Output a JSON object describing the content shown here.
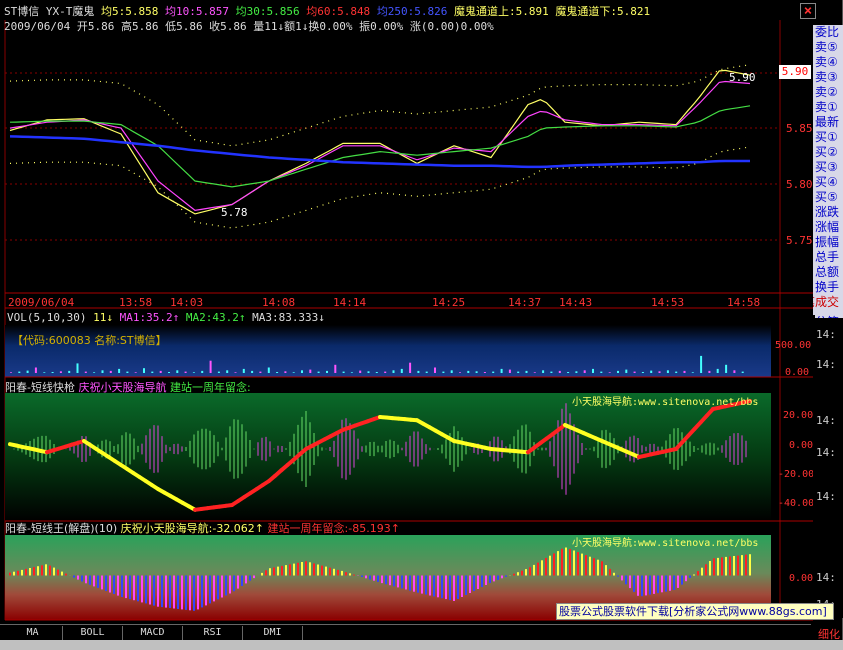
{
  "title_bar": {
    "stock": "ST博信",
    "indicator": "YX-T魔鬼",
    "ma5": "均5:5.858",
    "ma10": "均10:5.857",
    "ma30": "均30:5.856",
    "ma60": "均60:5.848",
    "ma250": "均250:5.826",
    "chan_up": "魔鬼通道上:5.891",
    "chan_down": "魔鬼通道下:5.821"
  },
  "quote_line": "2009/06/04 开5.86 高5.86 低5.86 收5.86 量11↓额1↓换0.00% 振0.00% 涨(0.00)0.00%",
  "price_panel": {
    "current_price_label": "5.90",
    "high_annotation": "5.90",
    "low_annotation": "5.78",
    "yticks": [
      "5.90",
      "5.85",
      "5.80",
      "5.75"
    ]
  },
  "time_axis": [
    "2009/06/04",
    "13:58",
    "14:03",
    "14:08",
    "14:14",
    "14:25",
    "14:37",
    "14:43",
    "14:53",
    "14:58"
  ],
  "side_panel": [
    "委比",
    "卖⑤",
    "卖④",
    "卖③",
    "卖②",
    "卖①",
    "最新",
    "买①",
    "买②",
    "买③",
    "买④",
    "买⑤",
    "涨跌",
    "涨幅",
    "振幅",
    "总手",
    "总额",
    "换手",
    "分笔成交",
    "分笔"
  ],
  "vol_panel": {
    "header_vol": "VOL(5,10,30)",
    "header_val": "11↓",
    "ma1": "MA1:35.2↑",
    "ma2": "MA2:43.2↑",
    "ma3": "MA3:83.333↓",
    "code_label": "【代码:600083 名称:ST博信】",
    "yticks": [
      "500.00",
      "0.00"
    ]
  },
  "osc_panel": {
    "title": "阳春-短线快枪",
    "sub1": "庆祝小天股海导航",
    "sub2": "建站一周年留念:",
    "watermark": "小天股海导航:www.sitenova.net/bbs",
    "yticks": [
      "20.00",
      "0.00",
      "-20.00",
      "-40.00"
    ]
  },
  "king_panel": {
    "title": "阳春-短线王(解盘)(10)",
    "sub1": "庆祝小天股海导航:-32.062↑",
    "sub2": "建站一周年留念:-85.193↑",
    "watermark": "小天股海导航:www.sitenova.net/bbs",
    "yticks": [
      "0.00"
    ]
  },
  "right_times": [
    "14:",
    "14:",
    "14:",
    "14:",
    "14:",
    "14:",
    "14:"
  ],
  "promo": "股票公式股票软件下载[分析家公式网www.88gs.com]",
  "tabs": [
    "MA",
    "BOLL",
    "MACD",
    "RSI",
    "DMI"
  ],
  "bottom_right": "细化",
  "colors": {
    "price_up": "#ff3333",
    "ma5": "#ffff66",
    "ma10": "#ff44ff",
    "ma30": "#44dd44",
    "ma250": "#2233ff",
    "grid": "#880000"
  },
  "chart_data": [
    {
      "type": "line",
      "title": "ST博信 YX-T魔鬼",
      "x": [
        0,
        0.05,
        0.1,
        0.15,
        0.2,
        0.25,
        0.3,
        0.35,
        0.4,
        0.45,
        0.5,
        0.55,
        0.6,
        0.65,
        0.7,
        0.72,
        0.75,
        0.8,
        0.85,
        0.9,
        0.93,
        0.96,
        1.0
      ],
      "series": [
        {
          "name": "均5",
          "values": [
            5.853,
            5.862,
            5.863,
            5.85,
            5.8,
            5.782,
            5.79,
            5.81,
            5.825,
            5.842,
            5.842,
            5.825,
            5.84,
            5.83,
            5.875,
            5.88,
            5.86,
            5.857,
            5.86,
            5.858,
            5.88,
            5.905,
            5.9
          ]
        },
        {
          "name": "均10",
          "values": [
            5.855,
            5.86,
            5.862,
            5.855,
            5.81,
            5.785,
            5.79,
            5.81,
            5.823,
            5.84,
            5.84,
            5.828,
            5.838,
            5.835,
            5.865,
            5.87,
            5.862,
            5.858,
            5.858,
            5.857,
            5.875,
            5.895,
            5.893
          ]
        },
        {
          "name": "均30",
          "values": [
            5.86,
            5.861,
            5.861,
            5.858,
            5.84,
            5.81,
            5.805,
            5.81,
            5.82,
            5.83,
            5.835,
            5.832,
            5.835,
            5.838,
            5.848,
            5.855,
            5.856,
            5.857,
            5.857,
            5.856,
            5.86,
            5.87,
            5.874
          ]
        },
        {
          "name": "均250",
          "values": [
            5.848,
            5.847,
            5.846,
            5.843,
            5.84,
            5.836,
            5.833,
            5.83,
            5.828,
            5.826,
            5.825,
            5.824,
            5.823,
            5.823,
            5.822,
            5.822,
            5.823,
            5.824,
            5.825,
            5.826,
            5.826,
            5.827,
            5.827
          ]
        }
      ],
      "ylim": [
        5.73,
        5.93
      ]
    },
    {
      "type": "bar",
      "title": "VOL(5,10,30)",
      "values": [
        10,
        20,
        35,
        80,
        10,
        15,
        25,
        30,
        140,
        20,
        10,
        40,
        30,
        60,
        20,
        10,
        70,
        20,
        30,
        15,
        40,
        20,
        10,
        30,
        180,
        20,
        40,
        10,
        60,
        30,
        20,
        80,
        15,
        25,
        10,
        40,
        50,
        20,
        30,
        120,
        20,
        10,
        35,
        25,
        15,
        20,
        40,
        60,
        150,
        30,
        20,
        80,
        20,
        40,
        10,
        30,
        25,
        15,
        20,
        60,
        50,
        20,
        30,
        10,
        40,
        20,
        30,
        15,
        25,
        40,
        60,
        20,
        10,
        30,
        50,
        20,
        15,
        35,
        25,
        40,
        20,
        30,
        10,
        250,
        30,
        60,
        120,
        40,
        20
      ],
      "ylim": [
        0,
        700
      ]
    },
    {
      "type": "bar",
      "title": "阳春-短线快枪",
      "x": [
        0,
        0.05,
        0.1,
        0.15,
        0.2,
        0.25,
        0.3,
        0.35,
        0.4,
        0.45,
        0.5,
        0.55,
        0.6,
        0.65,
        0.7,
        0.75,
        0.8,
        0.85,
        0.9,
        0.95,
        1.0
      ],
      "values": [
        0,
        -10,
        10,
        -25,
        25,
        -10,
        -30,
        20,
        -25,
        25,
        -20,
        15,
        -15,
        20,
        -25,
        30,
        -20,
        20,
        -15,
        -5,
        25
      ],
      "series": [
        {
          "name": "line",
          "values": [
            3,
            -2,
            5,
            -10,
            -25,
            -38,
            -35,
            -20,
            0,
            12,
            20,
            18,
            5,
            0,
            -2,
            15,
            5,
            -5,
            0,
            25,
            30
          ]
        }
      ],
      "ylim": [
        -45,
        35
      ]
    },
    {
      "type": "area",
      "title": "阳春-短线王(解盘)(10)",
      "x": [
        0,
        0.05,
        0.1,
        0.15,
        0.2,
        0.25,
        0.3,
        0.35,
        0.4,
        0.45,
        0.5,
        0.55,
        0.6,
        0.65,
        0.7,
        0.75,
        0.8,
        0.85,
        0.9,
        0.95,
        1.0
      ],
      "values": [
        2,
        8,
        -5,
        -15,
        -22,
        -25,
        -12,
        5,
        10,
        3,
        -5,
        -12,
        -18,
        -5,
        5,
        20,
        10,
        -15,
        -10,
        12,
        15
      ],
      "ylim": [
        -30,
        25
      ]
    }
  ]
}
